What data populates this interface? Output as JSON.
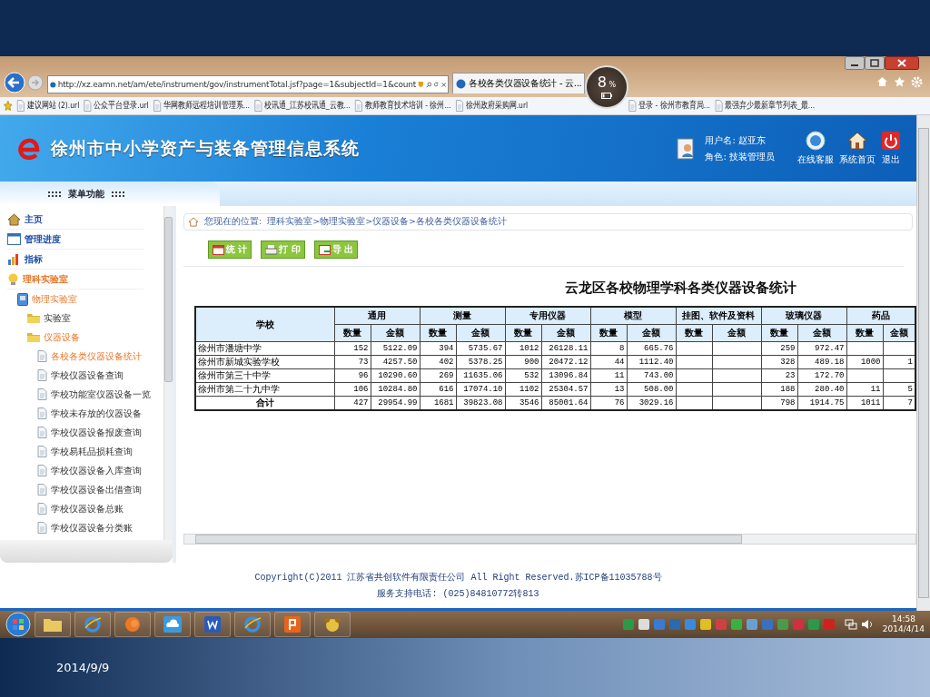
{
  "browser": {
    "address": "http://xz.eamn.net/am/ete/instrument/gov/instrumentTotal.jsf?page=1&subjectId=1&count",
    "tab_title": "各校各类仪器设备统计 - 云...",
    "battery_badge": {
      "value": "8",
      "unit": "%"
    },
    "favorites": [
      "建议网站 (2).url",
      "公众平台登录.url",
      "华网教师远程培训管理系...",
      "校讯通_江苏校讯通_云教...",
      "教师教育技术培训 - 徐州...",
      "徐州政府采购网.url",
      "登录 - 徐州市教育局...",
      "最强弃少最新章节列表_最..."
    ]
  },
  "header": {
    "title": "徐州市中小学资产与装备管理信息系统",
    "user_name": "用户名: 赵亚东",
    "role": "角色: 技装管理员",
    "actions": [
      "在线客服",
      "系统首页",
      "退出"
    ]
  },
  "menu": {
    "title": "::::  菜单功能  ::::",
    "items": [
      {
        "label": "主页",
        "selected": false
      },
      {
        "label": "管理进度",
        "selected": false
      },
      {
        "label": "指标",
        "selected": false
      },
      {
        "label": "理科实验室",
        "expanded": true,
        "children": [
          {
            "label": "物理实验室",
            "expanded": true,
            "children": [
              {
                "label": "实验室",
                "selected": false
              },
              {
                "label": "仪器设备",
                "expanded": true,
                "children": [
                  {
                    "label": "各校各类仪器设备统计",
                    "selected": true
                  },
                  {
                    "label": "学校仪器设备查询",
                    "selected": false
                  },
                  {
                    "label": "学校功能室仪器设备一览",
                    "selected": false
                  },
                  {
                    "label": "学校未存放的仪器设备",
                    "selected": false
                  },
                  {
                    "label": "学校仪器设备报废查询",
                    "selected": false
                  },
                  {
                    "label": "学校易耗品损耗查询",
                    "selected": false
                  },
                  {
                    "label": "学校仪器设备入库查询",
                    "selected": false
                  },
                  {
                    "label": "学校仪器设备出借查询",
                    "selected": false
                  },
                  {
                    "label": "学校仪器设备总账",
                    "selected": false
                  },
                  {
                    "label": "学校仪器设备分类账",
                    "selected": false
                  }
                ]
              }
            ]
          }
        ]
      }
    ]
  },
  "breadcrumb": {
    "label": "您现在的位置:",
    "path": "理科实验室>物理实验室>仪器设备>各校各类仪器设备统计"
  },
  "toolbar": [
    "统 计",
    "打 印",
    "导 出"
  ],
  "report": {
    "title": "云龙区各校物理学科各类仪器设备统计",
    "school_header": "学校",
    "groups": [
      {
        "name": "通用",
        "columns": [
          "数量",
          "金额"
        ]
      },
      {
        "name": "测量",
        "columns": [
          "数量",
          "金额"
        ]
      },
      {
        "name": "专用仪器",
        "columns": [
          "数量",
          "金额"
        ]
      },
      {
        "name": "模型",
        "columns": [
          "数量",
          "金额"
        ]
      },
      {
        "name": "挂图、软件及资料",
        "columns": [
          "数量",
          "金额"
        ]
      },
      {
        "name": "玻璃仪器",
        "columns": [
          "数量",
          "金额"
        ]
      },
      {
        "name": "药品",
        "columns": [
          "数量",
          "金额"
        ]
      }
    ],
    "rows": [
      {
        "kind": "data",
        "school": "徐州市潘塘中学",
        "general": [
          "152",
          "5122.09"
        ],
        "measuring": [
          "394",
          "5735.67"
        ],
        "special": [
          "1012",
          "26128.11"
        ],
        "model": [
          "8",
          "665.76"
        ],
        "glassware": [
          "259",
          "972.47"
        ]
      },
      {
        "kind": "data",
        "school": "徐州市新城实验学校",
        "general": [
          "73",
          "4257.50"
        ],
        "measuring": [
          "402",
          "5378.25"
        ],
        "special": [
          "900",
          "20472.12"
        ],
        "model": [
          "44",
          "1112.40"
        ],
        "glassware": [
          "328",
          "489.18"
        ],
        "chemicals": [
          "1000",
          "1"
        ]
      },
      {
        "kind": "data",
        "school": "徐州市第三十中学",
        "general": [
          "96",
          "10290.60"
        ],
        "measuring": [
          "269",
          "11635.06"
        ],
        "special": [
          "532",
          "13096.84"
        ],
        "model": [
          "11",
          "743.00"
        ],
        "glassware": [
          "23",
          "172.70"
        ]
      },
      {
        "kind": "data",
        "school": "徐州市第二十九中学",
        "general": [
          "106",
          "10284.80"
        ],
        "measuring": [
          "616",
          "17074.10"
        ],
        "special": [
          "1102",
          "25304.57"
        ],
        "model": [
          "13",
          "508.00"
        ],
        "glassware": [
          "188",
          "280.40"
        ],
        "chemicals": [
          "11",
          "5"
        ]
      },
      {
        "kind": "total",
        "school": "合计",
        "general": [
          "427",
          "29954.99"
        ],
        "measuring": [
          "1681",
          "39823.08"
        ],
        "special": [
          "3546",
          "85001.64"
        ],
        "model": [
          "76",
          "3029.16"
        ],
        "glassware": [
          "798",
          "1914.75"
        ],
        "chemicals": [
          "1011",
          "7"
        ]
      }
    ]
  },
  "footer": {
    "copyright": "Copyright(C)2011 江苏省共创软件有限责任公司 All Right Reserved.苏ICP备11035788号",
    "support": "服务支持电话: (025)84810772转813"
  },
  "taskbar": {
    "time": "14:58",
    "date": "2014/4/14"
  },
  "slide": {
    "date": "2014/9/9"
  }
}
